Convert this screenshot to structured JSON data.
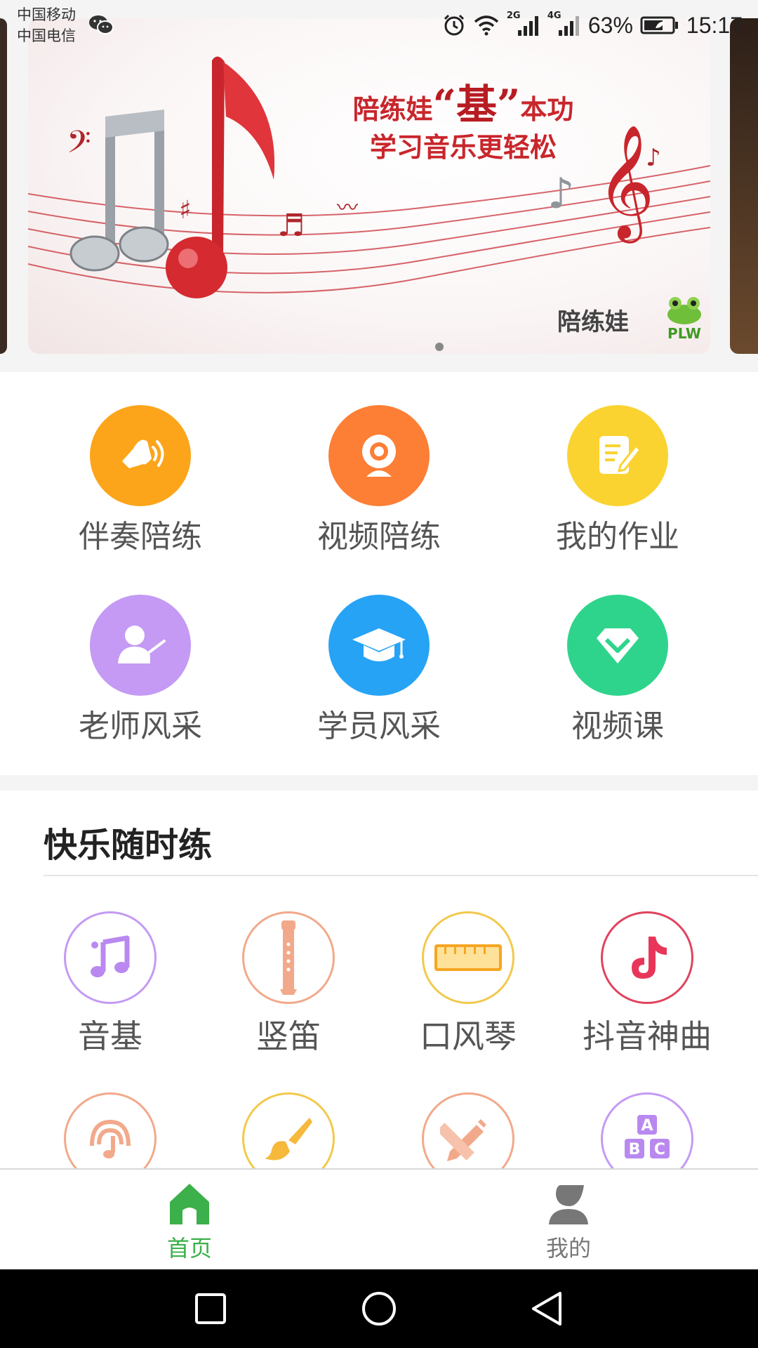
{
  "status_bar": {
    "carrier1": "中国移动",
    "carrier2": "中国电信",
    "net_2g": "2G",
    "net_4g": "4G",
    "battery_pct": "63%",
    "time": "15:17"
  },
  "banner": {
    "headline_prefix": "陪练娃",
    "headline_big": "“基”",
    "headline_suffix": "本功",
    "headline_line2": "学习音乐更轻松",
    "brand": "陪练娃",
    "logo_text": "PLW",
    "active_page": 1,
    "page_count": 1
  },
  "menu": [
    {
      "label": "伴奏陪练",
      "icon": "speaker-icon",
      "color": "#fca51b"
    },
    {
      "label": "视频陪练",
      "icon": "webcam-icon",
      "color": "#fd7e35"
    },
    {
      "label": "我的作业",
      "icon": "homework-icon",
      "color": "#fad331"
    },
    {
      "label": "老师风采",
      "icon": "teacher-icon",
      "color": "#c49af4"
    },
    {
      "label": "学员风采",
      "icon": "graduation-cap-icon",
      "color": "#26a3f5"
    },
    {
      "label": "视频课",
      "icon": "diamond-icon",
      "color": "#2fd48c"
    }
  ],
  "practice": {
    "title": "快乐随时练",
    "tools": [
      {
        "label": "音基",
        "icon": "music-notes-icon",
        "color": "#c49af4"
      },
      {
        "label": "竖笛",
        "icon": "recorder-icon",
        "color": "#f2a98b"
      },
      {
        "label": "口风琴",
        "icon": "melodica-icon",
        "color": "#f2c94c"
      },
      {
        "label": "抖音神曲",
        "icon": "tiktok-note-icon",
        "color": "#e0435e"
      },
      {
        "label": "",
        "icon": "listening-icon",
        "color": "#f2a98b"
      },
      {
        "label": "",
        "icon": "paintbrush-icon",
        "color": "#f2c94c"
      },
      {
        "label": "",
        "icon": "pencil-ruler-icon",
        "color": "#f2a98b"
      },
      {
        "label": "",
        "icon": "abc-blocks-icon",
        "color": "#c49af4"
      }
    ]
  },
  "bottom_nav": {
    "home_label": "首页",
    "mine_label": "我的",
    "active_color": "#3cb04a",
    "inactive_color": "#777777"
  }
}
